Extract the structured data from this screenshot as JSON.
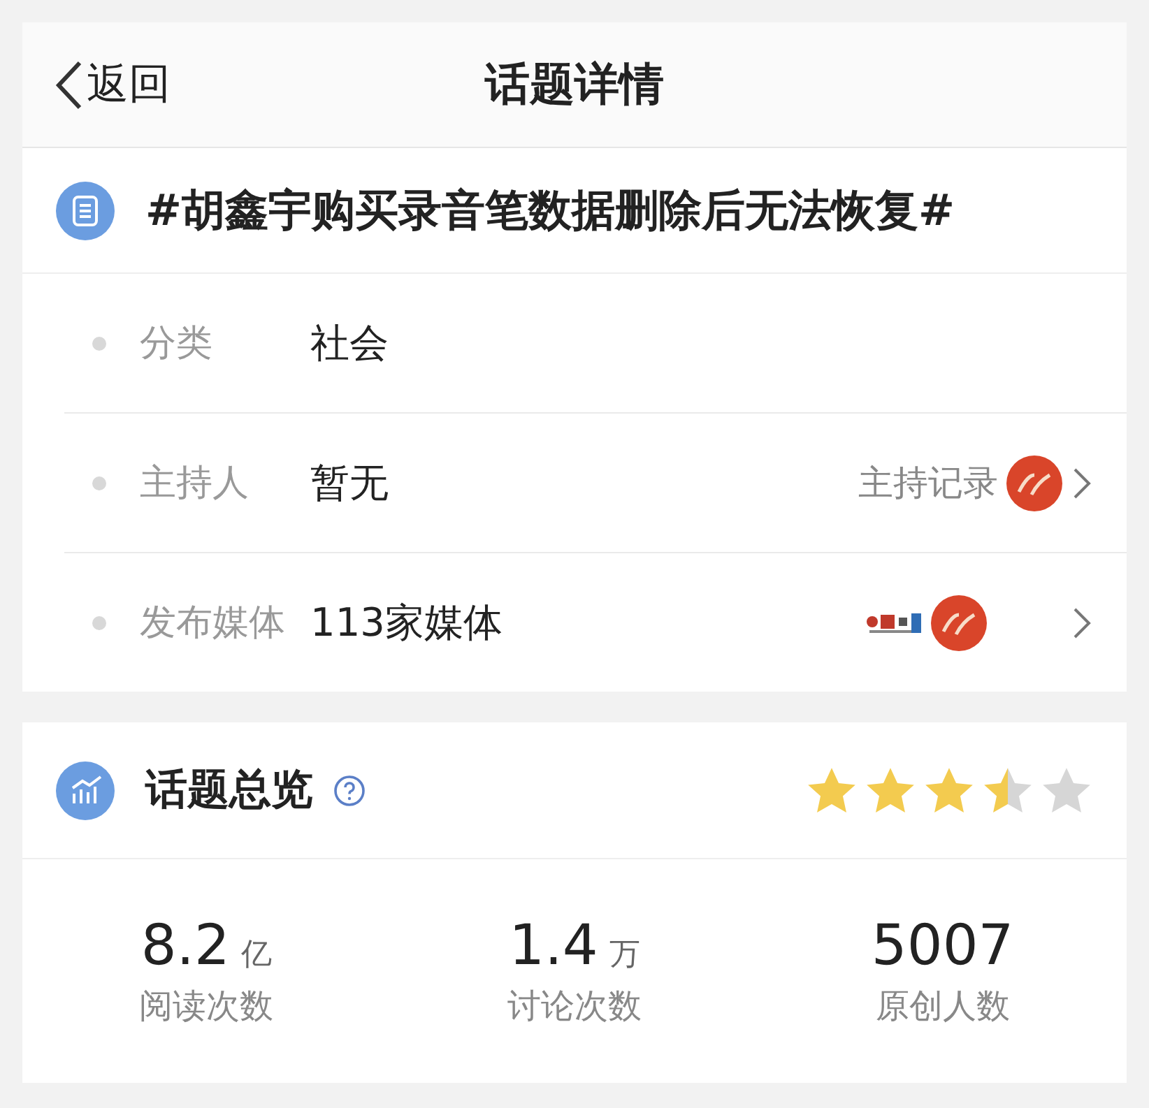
{
  "nav": {
    "back": "返回",
    "title": "话题详情"
  },
  "topic": {
    "title": "#胡鑫宇购买录音笔数据删除后无法恢复#"
  },
  "rows": [
    {
      "kind": "plain",
      "label": "分类",
      "value": "社会"
    },
    {
      "kind": "host",
      "label": "主持人",
      "value": "暂无",
      "link": "主持记录"
    },
    {
      "kind": "media",
      "label": "发布媒体",
      "value": "113家媒体"
    }
  ],
  "overview": {
    "title": "话题总览",
    "stars": 3.5,
    "stats": [
      {
        "number": "8.2",
        "unit": "亿",
        "label": "阅读次数"
      },
      {
        "number": "1.4",
        "unit": "万",
        "label": "讨论次数"
      },
      {
        "number": "5007",
        "label": "原创人数"
      }
    ]
  }
}
